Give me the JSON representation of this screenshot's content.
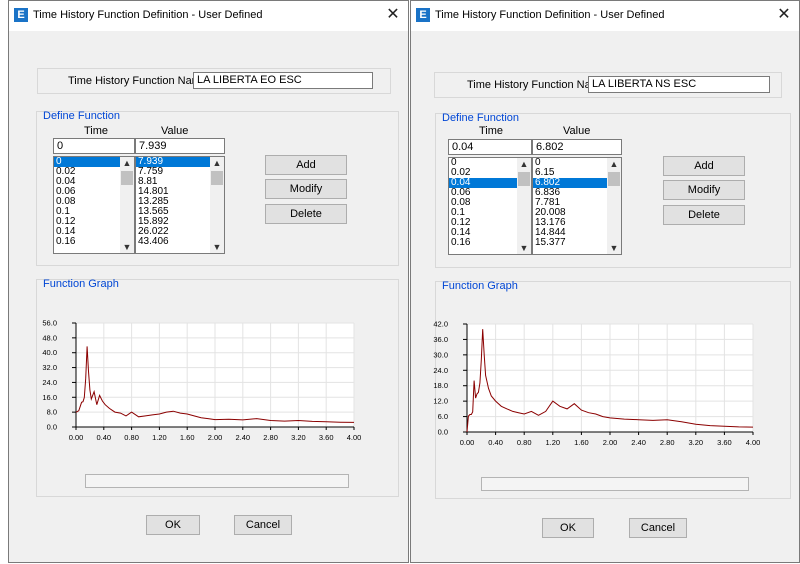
{
  "windows": [
    {
      "title": "Time History Function Definition  - User Defined",
      "close_glyph": "✕",
      "app_icon_letter": "E",
      "name_label": "Time History Function Name",
      "name_value": "LA LIBERTA EO ESC",
      "define_title": "Define Function",
      "time_header": "Time",
      "value_header": "Value",
      "time_input": "0",
      "value_input": "7.939",
      "time_list": [
        "0",
        "0.02",
        "0.04",
        "0.06",
        "0.08",
        "0.1",
        "0.12",
        "0.14",
        "0.16"
      ],
      "value_list": [
        "7.939",
        "7.759",
        "8.81",
        "14.801",
        "13.285",
        "13.565",
        "15.892",
        "26.022",
        "43.406"
      ],
      "selected_index": 0,
      "add_label": "Add",
      "modify_label": "Modify",
      "delete_label": "Delete",
      "graph_title": "Function Graph",
      "ok_label": "OK",
      "cancel_label": "Cancel",
      "chart_data": {
        "type": "line",
        "xlim": [
          0,
          4.0
        ],
        "ylim": [
          0,
          56.0
        ],
        "x_ticks": [
          "0.00",
          "0.40",
          "0.80",
          "1.20",
          "1.60",
          "2.00",
          "2.40",
          "2.80",
          "3.20",
          "3.60",
          "4.00"
        ],
        "y_ticks": [
          "0.0",
          "8.0",
          "16.0",
          "24.0",
          "32.0",
          "40.0",
          "48.0",
          "56.0"
        ],
        "grid": true,
        "line_color": "#8b0000",
        "x": [
          0,
          0.04,
          0.08,
          0.1,
          0.12,
          0.14,
          0.16,
          0.18,
          0.2,
          0.22,
          0.26,
          0.3,
          0.34,
          0.38,
          0.42,
          0.48,
          0.56,
          0.64,
          0.72,
          0.8,
          0.9,
          1.0,
          1.1,
          1.2,
          1.3,
          1.4,
          1.5,
          1.6,
          1.7,
          1.8,
          1.9,
          2.0,
          2.2,
          2.4,
          2.6,
          2.8,
          3.0,
          3.2,
          3.4,
          3.6,
          3.8,
          4.0
        ],
        "y": [
          7.9,
          8.8,
          13.3,
          13.6,
          15.9,
          26.0,
          43.4,
          30,
          20,
          15,
          19,
          12,
          17,
          14,
          12,
          10,
          8,
          7.5,
          6,
          8,
          5.5,
          6,
          6.5,
          7,
          8,
          8.5,
          7.5,
          7,
          6,
          5,
          4.5,
          4,
          4.2,
          3.8,
          4.5,
          3.5,
          3.2,
          3.5,
          3.0,
          2.8,
          2.6,
          2.5
        ]
      }
    },
    {
      "title": "Time History Function Definition  - User Defined",
      "close_glyph": "✕",
      "app_icon_letter": "E",
      "name_label": "Time History Function Name",
      "name_value": "LA LIBERTA NS ESC",
      "define_title": "Define Function",
      "time_header": "Time",
      "value_header": "Value",
      "time_input": "0.04",
      "value_input": "6.802",
      "time_list": [
        "0",
        "0.02",
        "0.04",
        "0.06",
        "0.08",
        "0.1",
        "0.12",
        "0.14",
        "0.16"
      ],
      "value_list": [
        "0",
        "6.15",
        "6.802",
        "6.836",
        "7.781",
        "20.008",
        "13.176",
        "14.844",
        "15.377"
      ],
      "selected_index": 2,
      "add_label": "Add",
      "modify_label": "Modify",
      "delete_label": "Delete",
      "graph_title": "Function Graph",
      "ok_label": "OK",
      "cancel_label": "Cancel",
      "chart_data": {
        "type": "line",
        "xlim": [
          0,
          4.0
        ],
        "ylim": [
          0,
          42.0
        ],
        "x_ticks": [
          "0.00",
          "0.40",
          "0.80",
          "1.20",
          "1.60",
          "2.00",
          "2.40",
          "2.80",
          "3.20",
          "3.60",
          "4.00"
        ],
        "y_ticks": [
          "0.0",
          "6.0",
          "12.0",
          "18.0",
          "24.0",
          "30.0",
          "36.0",
          "42.0"
        ],
        "grid": true,
        "line_color": "#8b0000",
        "x": [
          0,
          0.02,
          0.04,
          0.06,
          0.08,
          0.1,
          0.12,
          0.14,
          0.16,
          0.18,
          0.2,
          0.22,
          0.24,
          0.26,
          0.3,
          0.34,
          0.4,
          0.48,
          0.56,
          0.64,
          0.72,
          0.8,
          0.9,
          1.0,
          1.1,
          1.2,
          1.3,
          1.4,
          1.5,
          1.6,
          1.7,
          1.8,
          1.9,
          2.0,
          2.2,
          2.4,
          2.6,
          2.8,
          3.0,
          3.2,
          3.4,
          3.6,
          3.8,
          4.0
        ],
        "y": [
          0,
          6.2,
          6.8,
          6.8,
          7.8,
          20.0,
          13.2,
          14.8,
          15.4,
          19,
          28,
          40,
          30,
          22,
          17,
          14,
          12,
          10,
          9,
          8,
          7.5,
          7,
          8,
          6.5,
          8,
          12,
          10,
          9,
          11,
          8.5,
          7.5,
          7,
          6,
          5.5,
          5,
          4.8,
          4.5,
          4.8,
          4,
          3,
          2.5,
          2.2,
          2.0,
          1.9
        ]
      }
    }
  ]
}
